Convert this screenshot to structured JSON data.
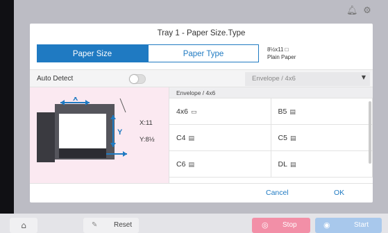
{
  "status_icons": [
    "notification-bell",
    "settings"
  ],
  "dialog": {
    "title": "Tray 1 - Paper Size.Type",
    "tabs": [
      {
        "label": "Paper Size",
        "active": true
      },
      {
        "label": "Paper Type",
        "active": false
      }
    ],
    "current_paper": {
      "size": "8½x11 □",
      "type": "Plain Paper"
    },
    "auto_detect": {
      "label": "Auto Detect",
      "enabled": false
    },
    "category_select": {
      "value": "Envelope / 4x6"
    },
    "preview": {
      "x_label": "X:11",
      "y_label": "Y:8½"
    },
    "list_header": "Envelope / 4x6",
    "sizes": [
      {
        "label": "4x6",
        "orientation_icon": "landscape-icon"
      },
      {
        "label": "B5",
        "orientation_icon": "portrait-icon"
      },
      {
        "label": "C4",
        "orientation_icon": "portrait-icon"
      },
      {
        "label": "C5",
        "orientation_icon": "portrait-icon"
      },
      {
        "label": "C6",
        "orientation_icon": "portrait-icon"
      },
      {
        "label": "DL",
        "orientation_icon": "portrait-icon"
      }
    ],
    "cancel_label": "Cancel",
    "ok_label": "OK"
  },
  "bottom_bar": {
    "reset_label": "Reset",
    "stop_label": "Stop",
    "start_label": "Start"
  },
  "colors": {
    "accent": "#1f7ac2",
    "stop": "#f28fa7",
    "start": "#a8c8ec"
  }
}
